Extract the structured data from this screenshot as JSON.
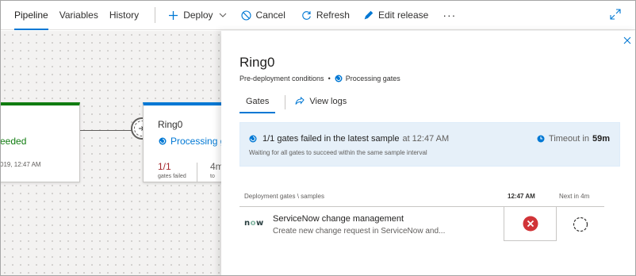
{
  "toolbar": {
    "tabs": [
      {
        "label": "Pipeline",
        "selected": true
      },
      {
        "label": "Variables",
        "selected": false
      },
      {
        "label": "History",
        "selected": false
      }
    ],
    "actions": {
      "deploy": "Deploy",
      "cancel": "Cancel",
      "refresh": "Refresh",
      "edit_release": "Edit release",
      "more": "···"
    },
    "icons": [
      "plus-icon",
      "chevron-down-icon",
      "cancel-icon",
      "refresh-icon",
      "pencil-icon",
      "expand-icon"
    ]
  },
  "canvas": {
    "prev_stage": {
      "status": "eeded",
      "date": "019, 12:47 AM"
    },
    "current_stage": {
      "name": "Ring0",
      "status": "Processing ga",
      "gates_failed_value": "1/1",
      "gates_failed_label": "gates failed",
      "next_value": "4m",
      "next_label": "to"
    }
  },
  "panel": {
    "title": "Ring0",
    "subtitle_prefix": "Pre-deployment conditions",
    "subtitle_separator": "•",
    "subtitle_status": "Processing gates",
    "tabs": {
      "gates": "Gates",
      "view_logs": "View logs"
    },
    "info": {
      "headline": "1/1 gates failed in the latest sample",
      "headline_time": "at 12:47 AM",
      "detail": "Waiting for all gates to succeed within the same sample interval",
      "timeout_label": "Timeout in",
      "timeout_value": "59m"
    },
    "table": {
      "col_gates": "Deployment gates \\ samples",
      "col_sample": "12:47 AM",
      "col_next": "Next in 4m",
      "rows": [
        {
          "logo": "now",
          "name": "ServiceNow change management",
          "description": "Create new change request in ServiceNow and...",
          "sample_status": "failed",
          "next_status": "pending"
        }
      ]
    }
  },
  "colors": {
    "accent": "#0078d4",
    "success": "#107c10",
    "error": "#d13438",
    "info_bg": "#e6f0f9"
  }
}
